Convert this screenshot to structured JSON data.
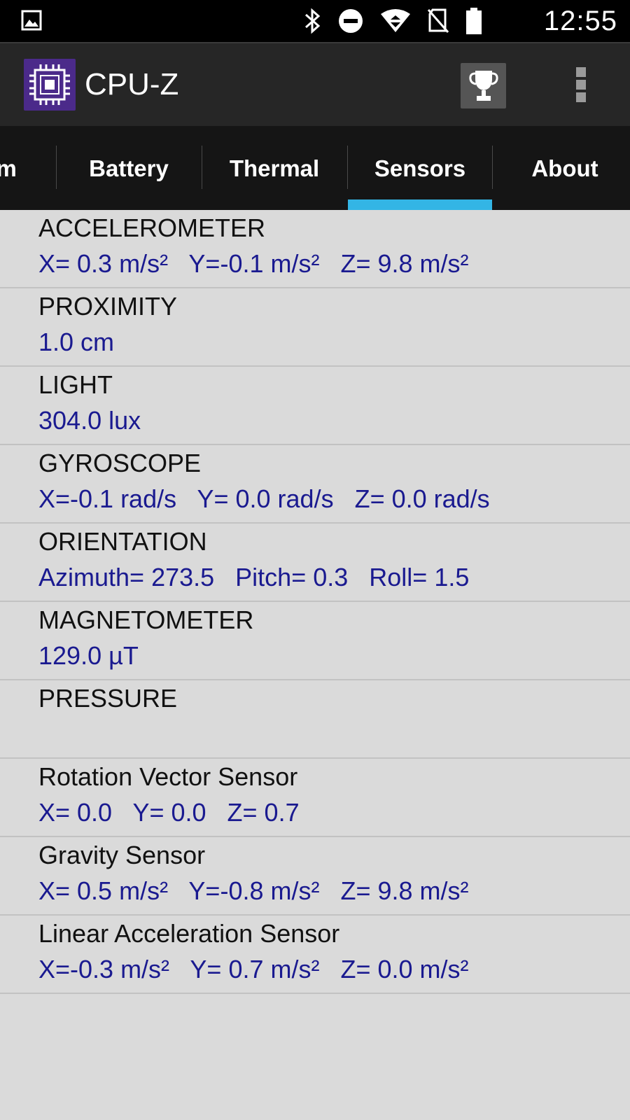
{
  "status_bar": {
    "time": "12:55",
    "icons": [
      "gallery-icon",
      "bluetooth-icon",
      "do-not-disturb-icon",
      "wifi-icon",
      "no-sim-icon",
      "battery-icon"
    ]
  },
  "app_bar": {
    "title": "CPU-Z",
    "logo_icon": "cpu-chip-icon",
    "trophy_icon": "trophy-icon",
    "menu_icon": "overflow-menu-icon"
  },
  "tabs": [
    {
      "label": "em"
    },
    {
      "label": "Battery"
    },
    {
      "label": "Thermal"
    },
    {
      "label": "Sensors",
      "selected": true
    },
    {
      "label": "About"
    }
  ],
  "accent_color": "#33b5e5",
  "sensors": [
    {
      "name": "ACCELEROMETER",
      "value": "X= 0.3 m/s²   Y=-0.1 m/s²   Z= 9.8 m/s²"
    },
    {
      "name": "PROXIMITY",
      "value": "1.0 cm"
    },
    {
      "name": "LIGHT",
      "value": "304.0 lux"
    },
    {
      "name": "GYROSCOPE",
      "value": "X=-0.1 rad/s   Y= 0.0 rad/s   Z= 0.0 rad/s"
    },
    {
      "name": "ORIENTATION",
      "value": "Azimuth= 273.5   Pitch= 0.3   Roll= 1.5"
    },
    {
      "name": "MAGNETOMETER",
      "value": "129.0 µT"
    },
    {
      "name": "PRESSURE",
      "value": ""
    },
    {
      "name": "Rotation Vector Sensor",
      "value": "X= 0.0   Y= 0.0   Z= 0.7"
    },
    {
      "name": "Gravity Sensor",
      "value": "X= 0.5 m/s²   Y=-0.8 m/s²   Z= 9.8 m/s²"
    },
    {
      "name": "Linear Acceleration Sensor",
      "value": "X=-0.3 m/s²   Y= 0.7 m/s²   Z= 0.0 m/s²"
    }
  ]
}
